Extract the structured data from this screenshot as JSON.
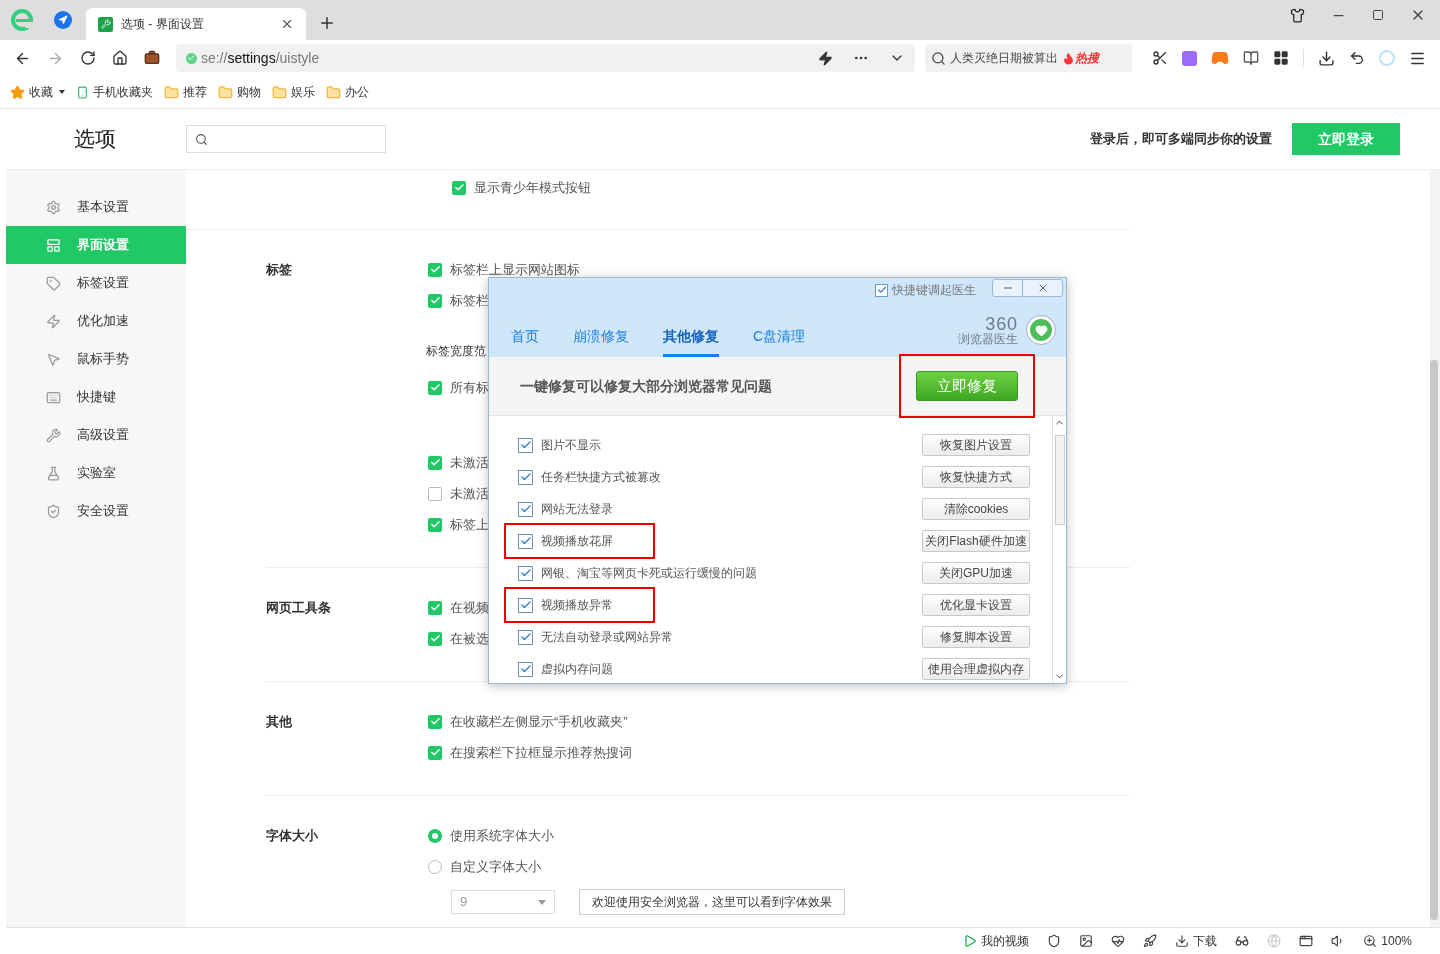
{
  "tabs": [
    {
      "title": "选项 - 界面设置",
      "selected": true
    }
  ],
  "address": {
    "scheme": "se://",
    "host": "settings",
    "path": "/uistyle"
  },
  "search": {
    "value": "人类灭绝日期被算出",
    "badge": "热搜"
  },
  "bookmarks": [
    {
      "label": "收藏",
      "kind": "star"
    },
    {
      "label": "手机收藏夹",
      "kind": "phone"
    },
    {
      "label": "推荐",
      "kind": "folder"
    },
    {
      "label": "购物",
      "kind": "folder"
    },
    {
      "label": "娱乐",
      "kind": "folder"
    },
    {
      "label": "办公",
      "kind": "folder"
    }
  ],
  "settings": {
    "title": "选项",
    "login_hint": "登录后，即可多端同步你的设置",
    "login_button": "立即登录",
    "sidebar": [
      {
        "label": "基本设置",
        "selected": false
      },
      {
        "label": "界面设置",
        "selected": true
      },
      {
        "label": "标签设置",
        "selected": false
      },
      {
        "label": "优化加速",
        "selected": false
      },
      {
        "label": "鼠标手势",
        "selected": false
      },
      {
        "label": "快捷键",
        "selected": false
      },
      {
        "label": "高级设置",
        "selected": false
      },
      {
        "label": "实验室",
        "selected": false
      },
      {
        "label": "安全设置",
        "selected": false
      }
    ],
    "sections": [
      {
        "options": [
          {
            "kind": "checkbox",
            "label": "显示青少年模式按钮",
            "checked": true
          }
        ]
      },
      {
        "title": "标签",
        "options": [
          {
            "kind": "checkbox",
            "label": "标签栏上显示网站图标",
            "checked": true
          },
          {
            "kind": "checkbox",
            "label": "标签栏",
            "checked": true
          },
          {
            "kind": "heading",
            "label": "标签宽度范"
          },
          {
            "kind": "checkbox",
            "label": "所有标",
            "checked": true
          },
          {
            "kind": "spacer"
          },
          {
            "kind": "checkbox",
            "label": "未激活",
            "checked": true
          },
          {
            "kind": "checkbox",
            "label": "未激活",
            "checked": false
          },
          {
            "kind": "checkbox",
            "label": "标签上",
            "checked": true
          }
        ]
      },
      {
        "title": "网页工具条",
        "options": [
          {
            "kind": "checkbox",
            "label": "在视频",
            "checked": true
          },
          {
            "kind": "checkbox",
            "label": "在被选",
            "checked": true
          }
        ]
      },
      {
        "title": "其他",
        "options": [
          {
            "kind": "checkbox",
            "label": "在收藏栏左侧显示“手机收藏夹”",
            "checked": true
          },
          {
            "kind": "checkbox",
            "label": "在搜索栏下拉框显示推荐热搜词",
            "checked": true
          }
        ]
      },
      {
        "title": "字体大小",
        "options": [
          {
            "kind": "radio",
            "label": "使用系统字体大小",
            "selected": true
          },
          {
            "kind": "radio",
            "label": "自定义字体大小",
            "selected": false
          },
          {
            "kind": "font",
            "value": "9",
            "preview": "欢迎使用安全浏览器，这里可以看到字体效果"
          }
        ]
      }
    ]
  },
  "doctor": {
    "hotkey": {
      "label": "快捷键调起医生",
      "checked": true
    },
    "tabs": [
      {
        "label": "首页",
        "selected": false
      },
      {
        "label": "崩溃修复",
        "selected": false
      },
      {
        "label": "其他修复",
        "selected": true
      },
      {
        "label": "C盘清理",
        "selected": false
      }
    ],
    "logo": {
      "mark": "360",
      "name": "浏览器医生"
    },
    "hint": "一键修复可以修复大部分浏览器常见问题",
    "fix_button": {
      "label": "立即修复",
      "highlighted": true
    },
    "items": [
      {
        "label": "图片不显示",
        "action": "恢复图片设置",
        "checked": true,
        "highlighted": false
      },
      {
        "label": "任务栏快捷方式被篡改",
        "action": "恢复快捷方式",
        "checked": true,
        "highlighted": false
      },
      {
        "label": "网站无法登录",
        "action": "清除cookies",
        "checked": true,
        "highlighted": false
      },
      {
        "label": "视频播放花屏",
        "action": "关闭Flash硬件加速",
        "checked": true,
        "highlighted": true
      },
      {
        "label": "网银、淘宝等网页卡死或运行缓慢的问题",
        "action": "关闭GPU加速",
        "checked": true,
        "highlighted": false
      },
      {
        "label": "视频播放异常",
        "action": "优化显卡设置",
        "checked": true,
        "highlighted": true
      },
      {
        "label": "无法自动登录或网站异常",
        "action": "修复脚本设置",
        "checked": true,
        "highlighted": false
      },
      {
        "label": "虚拟内存问题",
        "action": "使用合理虚拟内存",
        "checked": true,
        "highlighted": false
      }
    ]
  },
  "status_bar": [
    {
      "kind": "video",
      "label": "我的视频"
    },
    {
      "kind": "shield"
    },
    {
      "kind": "image"
    },
    {
      "kind": "pulse"
    },
    {
      "kind": "rocket"
    },
    {
      "kind": "download",
      "label": "下载"
    },
    {
      "kind": "glasses"
    },
    {
      "kind": "ie"
    },
    {
      "kind": "window"
    },
    {
      "kind": "sound"
    },
    {
      "kind": "zoom",
      "label": "100%"
    }
  ]
}
